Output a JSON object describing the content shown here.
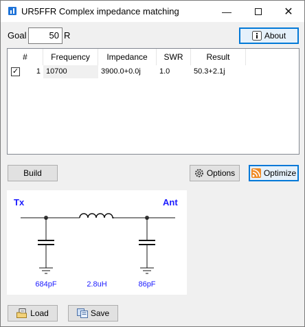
{
  "window": {
    "title": "UR5FFR Complex impedance matching"
  },
  "goal": {
    "label": "Goal",
    "value": "50",
    "unit": "R"
  },
  "buttons": {
    "about": "About",
    "build": "Build",
    "options": "Options",
    "optimize": "Optimize",
    "load": "Load",
    "save": "Save"
  },
  "table": {
    "headers": [
      "#",
      "Frequency",
      "Impedance",
      "SWR",
      "Result"
    ],
    "rows": [
      {
        "index": "1",
        "frequency": "10700",
        "impedance": "3900.0+0.0j",
        "swr": "1.0",
        "result": "50.3+2.1j",
        "checked": true
      }
    ]
  },
  "schematic": {
    "port_left": "Tx",
    "port_right": "Ant",
    "components": {
      "c1": "684pF",
      "l1": "2.8uH",
      "c2": "86pF"
    },
    "accent_color": "#1a1aff"
  }
}
